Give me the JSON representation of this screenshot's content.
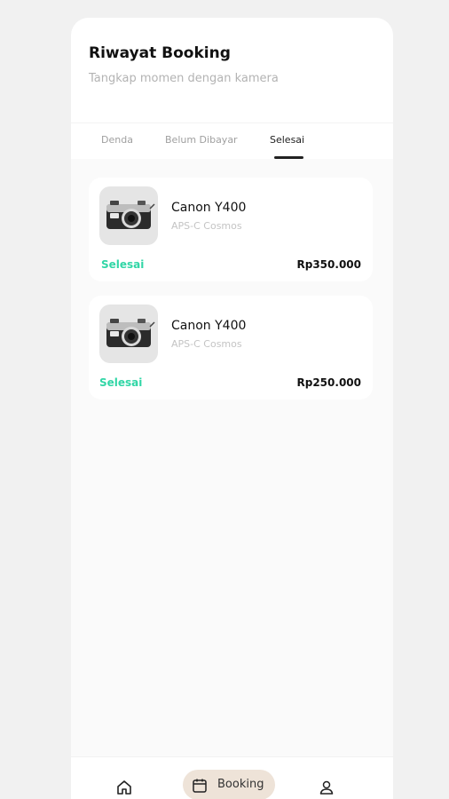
{
  "header": {
    "title": "Riwayat Booking",
    "subtitle": "Tangkap momen dengan kamera"
  },
  "tabs": [
    {
      "label": "Denda",
      "active": false
    },
    {
      "label": "Belum Dibayar",
      "active": false
    },
    {
      "label": "Selesai",
      "active": true
    }
  ],
  "bookings": [
    {
      "name": "Canon Y400",
      "category": "APS-C Cosmos",
      "status": "Selesai",
      "price": "Rp350.000",
      "icon": "camera-image"
    },
    {
      "name": "Canon Y400",
      "category": "APS-C Cosmos",
      "status": "Selesai",
      "price": "Rp250.000",
      "icon": "camera-image"
    }
  ],
  "bottom_nav": {
    "home_icon": "home-icon",
    "booking_label": "Booking",
    "booking_icon": "calendar-icon",
    "profile_icon": "user-icon",
    "active": "booking",
    "active_color": "#eee3d8"
  },
  "colors": {
    "status": "#31d6a6",
    "background": "#fafafa"
  }
}
